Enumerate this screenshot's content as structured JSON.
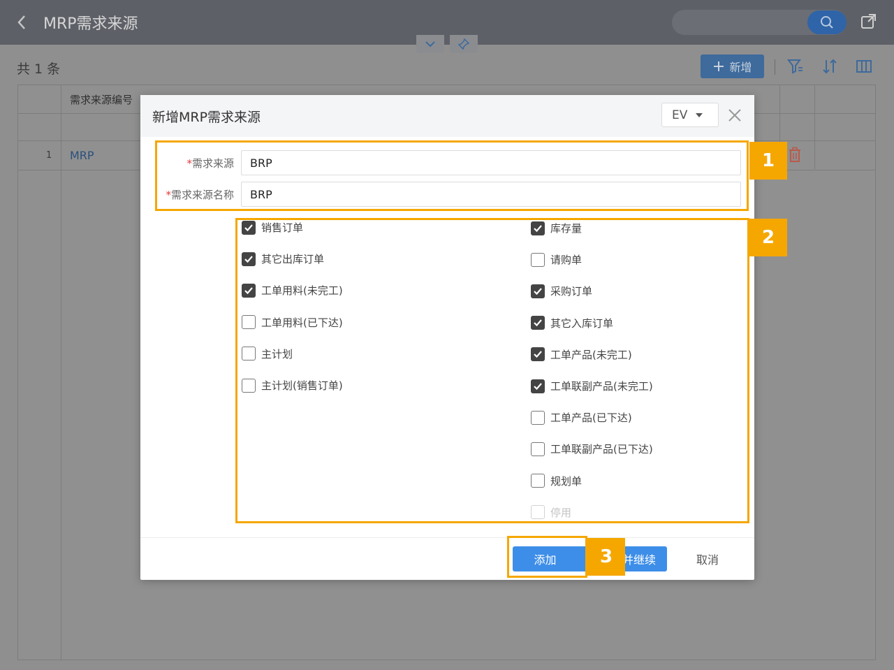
{
  "header": {
    "title": "MRP需求来源"
  },
  "toolbar": {
    "count_text": "共 1 条",
    "add_new_label": "新增"
  },
  "table": {
    "first_header": "需求来源编号",
    "rows": [
      {
        "index": "1",
        "code": "MRP"
      }
    ]
  },
  "modal": {
    "title": "新增MRP需求来源",
    "language": "EV",
    "fields": [
      {
        "label": "需求来源",
        "required_mark": "*",
        "value": "BRP"
      },
      {
        "label": "需求来源名称",
        "required_mark": "*",
        "value": "BRP"
      }
    ],
    "left_checkboxes": [
      {
        "label": "销售订单",
        "checked": true
      },
      {
        "label": "其它出库订单",
        "checked": true
      },
      {
        "label": "工单用料(未完工)",
        "checked": true
      },
      {
        "label": "工单用料(已下达)",
        "checked": false
      },
      {
        "label": "主计划",
        "checked": false
      },
      {
        "label": "主计划(销售订单)",
        "checked": false
      }
    ],
    "right_checkboxes": [
      {
        "label": "库存量",
        "checked": true
      },
      {
        "label": "请购单",
        "checked": false
      },
      {
        "label": "采购订单",
        "checked": true
      },
      {
        "label": "其它入库订单",
        "checked": true
      },
      {
        "label": "工单产品(未完工)",
        "checked": true
      },
      {
        "label": "工单联副产品(未完工)",
        "checked": true
      },
      {
        "label": "工单产品(已下达)",
        "checked": false
      },
      {
        "label": "工单联副产品(已下达)",
        "checked": false
      },
      {
        "label": "规划单",
        "checked": false
      },
      {
        "label": "停用",
        "checked": false,
        "disabled": true
      }
    ],
    "buttons": {
      "add_label": "添加",
      "add_continue_label": "并继续",
      "cancel_label": "取消"
    }
  },
  "annotations": [
    {
      "label": "1"
    },
    {
      "label": "2"
    },
    {
      "label": "3"
    }
  ],
  "colors": {
    "primary": "#3d8ee8",
    "annotation": "#f5a700",
    "required": "#e23b3b"
  }
}
